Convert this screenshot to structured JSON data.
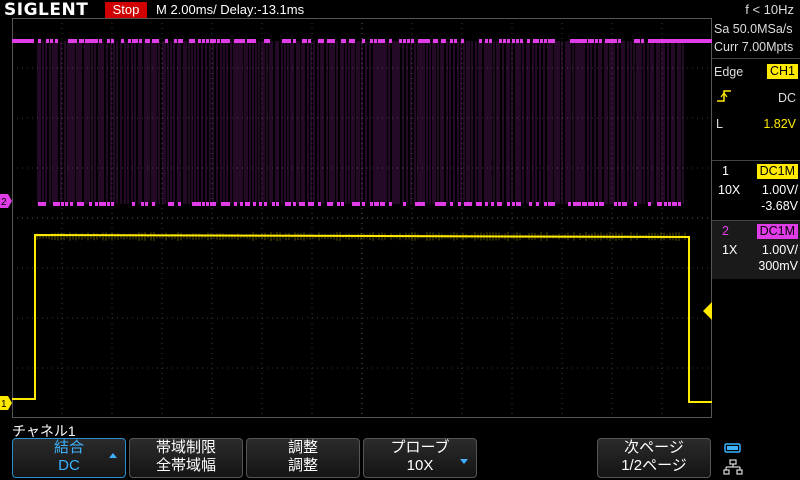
{
  "header": {
    "brand": "SIGLENT",
    "run_state": "Stop",
    "timebase": "M 2.00ms/ Delay:-13.1ms",
    "frequency": "f < 10Hz"
  },
  "acquisition": {
    "sample_rate": "Sa 50.0MSa/s",
    "memory": "Curr 7.00Mpts"
  },
  "trigger": {
    "type_label": "Edge",
    "source": "CH1",
    "coupling": "DC",
    "level_label": "L",
    "level": "1.82V"
  },
  "channel1": {
    "number": "1",
    "coupling": "DC1M",
    "probe": "10X",
    "scale": "1.00V/",
    "offset": "-3.68V",
    "marker": "1"
  },
  "channel2": {
    "number": "2",
    "coupling": "DC1M",
    "probe": "1X",
    "scale": "1.00V/",
    "offset": "300mV",
    "marker": "2"
  },
  "menu": {
    "title": "チャネル1",
    "buttons": [
      {
        "line1": "結合",
        "line2": "DC"
      },
      {
        "line1": "帯域制限",
        "line2": "全帯域幅"
      },
      {
        "line1": "調整",
        "line2": "調整"
      },
      {
        "line1": "プローブ",
        "line2": "10X"
      },
      {
        "line1": "次ページ",
        "line2": "1/2ページ"
      }
    ]
  },
  "colors": {
    "ch1": "#ffea00",
    "ch2": "#e03ce8",
    "accent": "#3db3ff",
    "stop": "#d00000"
  }
}
